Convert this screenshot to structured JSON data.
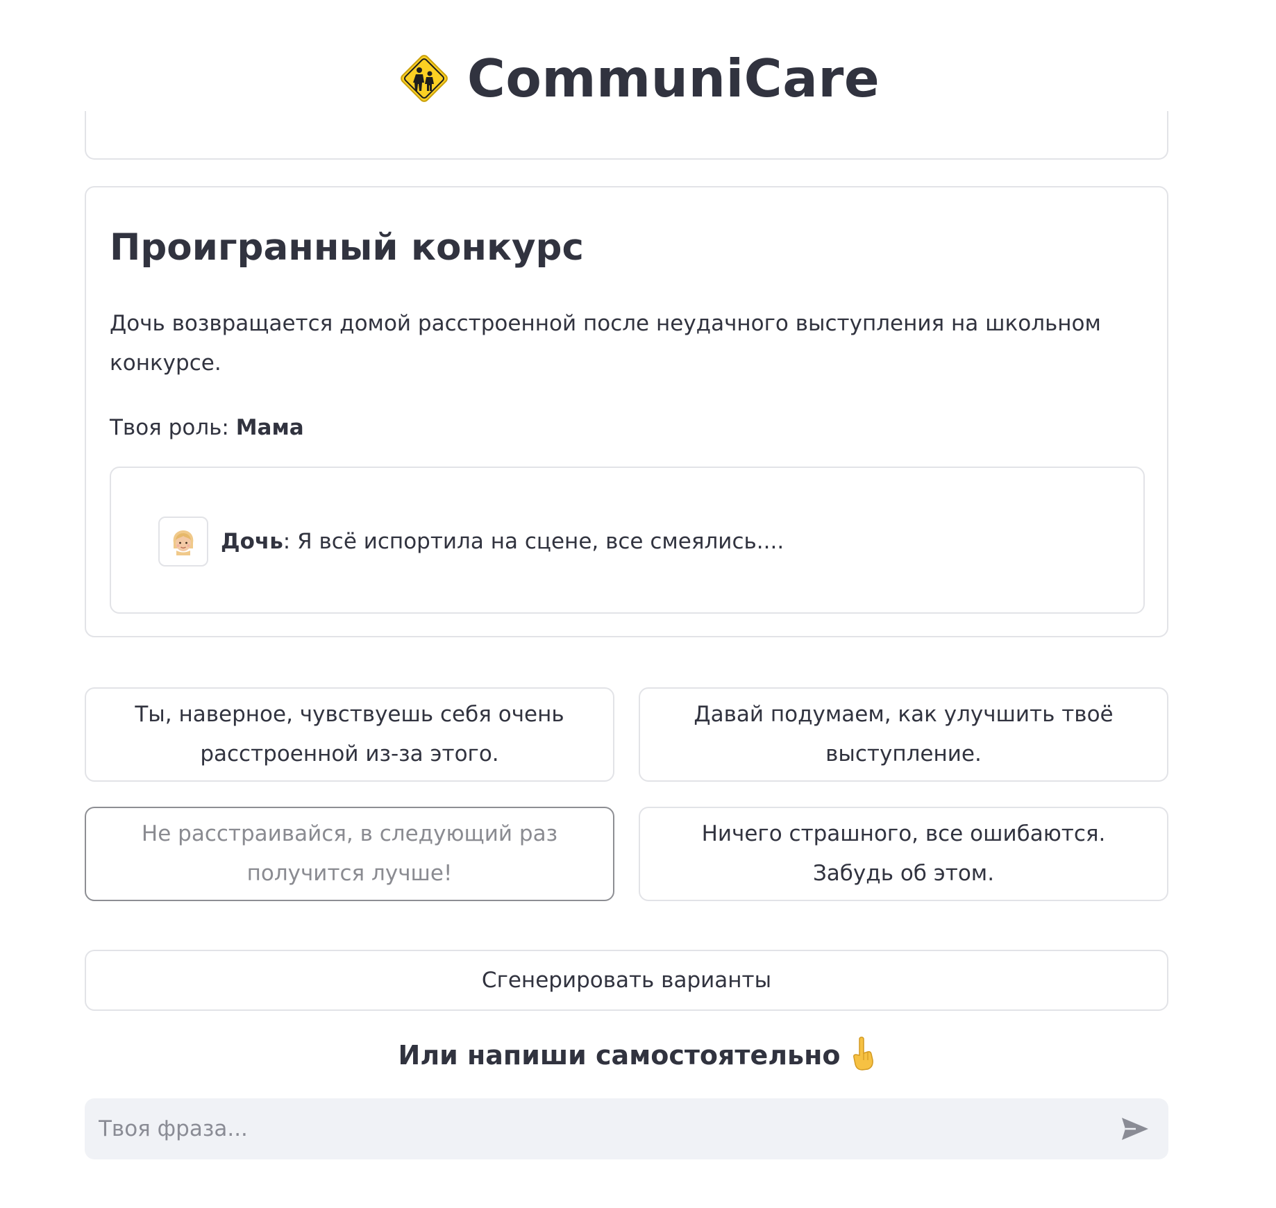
{
  "header": {
    "logo_icon": "children-crossing-icon",
    "title": "CommuniCare"
  },
  "scenario": {
    "title": "Проигранный конкурс",
    "description": "Дочь возвращается домой расстроенной после неудачного выступления на школьном конкурсе.",
    "role_prefix": "Твоя роль: ",
    "role_name": "Мама",
    "message": {
      "avatar_icon": "girl-emoji-icon",
      "speaker": "Дочь",
      "separator": ": ",
      "text": "Я всё испортила на сцене, все смеялись...."
    }
  },
  "options": [
    {
      "label": "Ты, наверное, чувствуешь себя очень расстроенной из-за этого.",
      "selected": false
    },
    {
      "label": "Давай подумаем, как улучшить твоё выступление.",
      "selected": false
    },
    {
      "label": "Не расстраивайся, в следующий раз получится лучше!",
      "selected": true
    },
    {
      "label": "Ничего страшного, все ошибаются. Забудь об этом.",
      "selected": false
    }
  ],
  "generate_button": {
    "label": "Сгенерировать варианты"
  },
  "write_prompt": {
    "text": "Или напиши самостоятельно",
    "icon": "pointing-down-icon"
  },
  "chat_input": {
    "placeholder": "Твоя фраза...",
    "value": "",
    "send_icon": "send-icon"
  },
  "colors": {
    "text": "#31333f",
    "border": "#e2e3e7",
    "input_bg": "#f0f2f6",
    "logo_yellow": "#fcd023",
    "send_icon": "#8a8c95"
  }
}
